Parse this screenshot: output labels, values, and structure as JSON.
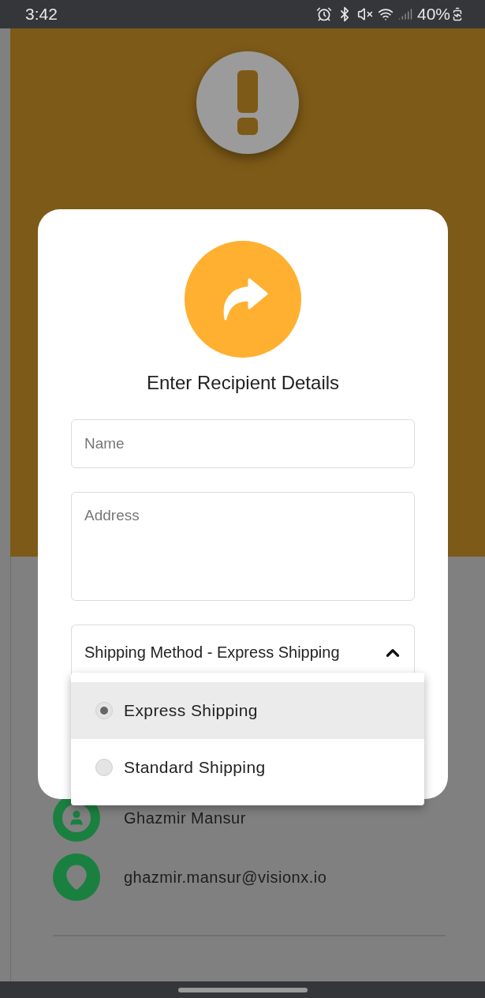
{
  "status_bar": {
    "time": "3:42",
    "battery": "40%"
  },
  "recipient_dialog": {
    "title": "Enter Recipient Details",
    "fields": [
      {
        "kind": "single",
        "placeholder": "Name"
      },
      {
        "kind": "multi",
        "placeholder": "Address"
      }
    ],
    "shipping_select": {
      "value": "Shipping Method - Express Shipping",
      "expanded": true,
      "options": [
        {
          "label": "Express Shipping",
          "selected": true
        },
        {
          "label": "Standard Shipping",
          "selected": false
        }
      ]
    }
  },
  "contact": [
    {
      "kind": "person",
      "text": "Ghazmir Mansur"
    },
    {
      "kind": "location",
      "text": "ghazmir.mansur@visionx.io"
    }
  ]
}
